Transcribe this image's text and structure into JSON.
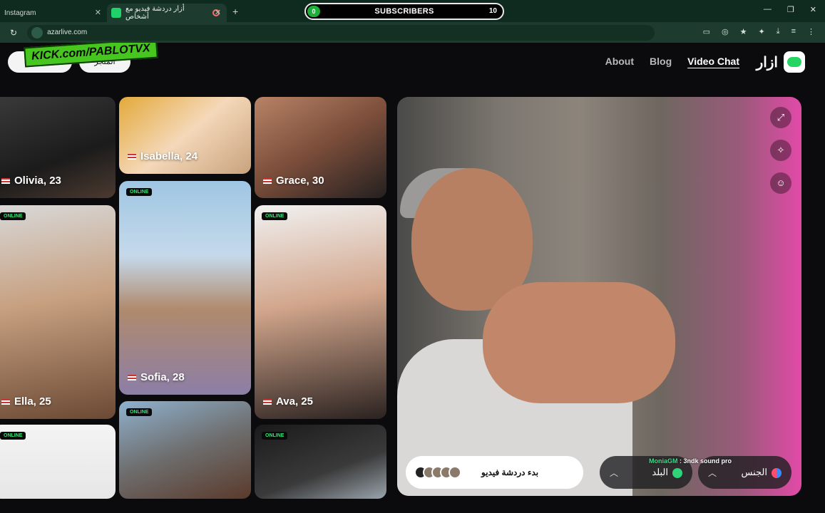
{
  "browser": {
    "tabs": [
      {
        "label": "Instagram"
      },
      {
        "label": "أزار دردشة فيديو مع أشخاص"
      }
    ],
    "url": "azarlive.com"
  },
  "overlay": {
    "subscribers_label": "SUBSCRIBERS",
    "subscribers_start": "0",
    "subscribers_goal": "10",
    "kick_banner": "KICK.com/PABLOTVX",
    "chat_user": "MoniaGM",
    "chat_text": " : 3ndk sound pro"
  },
  "header": {
    "pill1": "",
    "pill2": "المتجر",
    "nav": [
      "About",
      "Blog",
      "Video Chat"
    ],
    "brand": "ازار"
  },
  "cards": [
    {
      "name": "Olivia, 23"
    },
    {
      "name": "Isabella, 24"
    },
    {
      "name": "Grace, 30"
    },
    {
      "name": "Ella, 25",
      "online": "ONLINE"
    },
    {
      "name": "Sofia, 28",
      "online": "ONLINE"
    },
    {
      "name": "Ava, 25",
      "online": "ONLINE"
    },
    {
      "name": "",
      "online": "ONLINE"
    },
    {
      "name": "",
      "online": "ONLINE"
    },
    {
      "name": "",
      "online": "ONLINE"
    }
  ],
  "controls": {
    "start_chat": "بدء دردشة فيديو",
    "country_filter": "البلد",
    "gender_filter": "الجنس"
  },
  "icons": {
    "fullscreen": "expand-icon",
    "effects": "magic-wand-icon",
    "mask": "face-mask-icon"
  }
}
